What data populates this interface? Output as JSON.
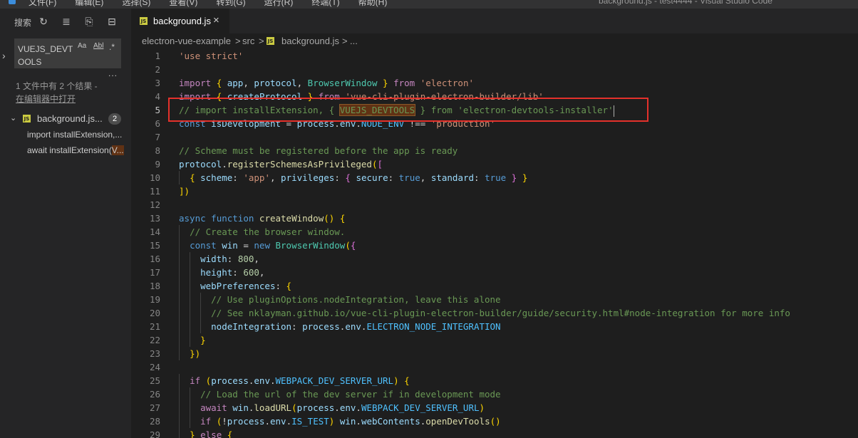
{
  "window": {
    "menu": [
      "文件(F)",
      "编辑(E)",
      "选择(S)",
      "查看(V)",
      "转到(G)",
      "运行(R)",
      "终端(T)",
      "帮助(H)"
    ],
    "title": "background.js - test4444 - Visual Studio Code"
  },
  "sidebar": {
    "title": "搜索",
    "search_value": "VUEJS_DEVTOOLS",
    "options": [
      "Aa",
      "Abl",
      ".*"
    ],
    "more": "...",
    "summary": "1 文件中有 2 个结果 -",
    "open_in_editor": "在编辑器中打开",
    "file": {
      "name": "background.js...",
      "count": "2"
    },
    "matches": [
      {
        "before": "import installExtension,...",
        "hl": ""
      },
      {
        "before": "await installExtension(",
        "hl": "V..."
      }
    ]
  },
  "tab": {
    "label": "background.js",
    "close": "×"
  },
  "breadcrumb": [
    "electron-vue-example",
    ">",
    "src",
    ">",
    "background.js",
    ">",
    "..."
  ],
  "editor": {
    "active_line": 5,
    "lines": [
      "'use strict'",
      "",
      "import { app, protocol, BrowserWindow } from 'electron'",
      "import { createProtocol } from 'vue-cli-plugin-electron-builder/lib'",
      "// import installExtension, { VUEJS_DEVTOOLS } from 'electron-devtools-installer'",
      "const isDevelopment = process.env.NODE_ENV !== 'production'",
      "",
      "// Scheme must be registered before the app is ready",
      "protocol.registerSchemesAsPrivileged([",
      "  { scheme: 'app', privileges: { secure: true, standard: true } }",
      "])",
      "",
      "async function createWindow() {",
      "  // Create the browser window.",
      "  const win = new BrowserWindow({",
      "    width: 800,",
      "    height: 600,",
      "    webPreferences: {",
      "      // Use pluginOptions.nodeIntegration, leave this alone",
      "      // See nklayman.github.io/vue-cli-plugin-electron-builder/guide/security.html#node-integration for more info",
      "      nodeIntegration: process.env.ELECTRON_NODE_INTEGRATION",
      "    }",
      "  })",
      "",
      "  if (process.env.WEBPACK_DEV_SERVER_URL) {",
      "    // Load the url of the dev server if in development mode",
      "    await win.loadURL(process.env.WEBPACK_DEV_SERVER_URL)",
      "    if (!process.env.IS_TEST) win.webContents.openDevTools()",
      "  } else {"
    ]
  },
  "colors": {
    "highlight_box": "#e4312b",
    "find_match": "#613214",
    "js_badge": "#cbcb41"
  }
}
